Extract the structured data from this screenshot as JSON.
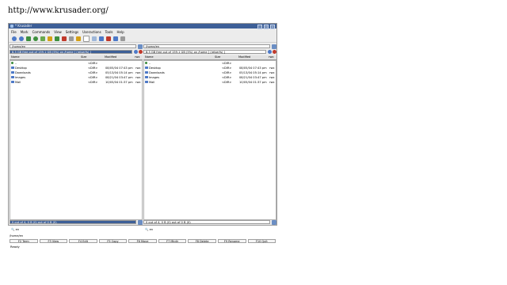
{
  "page_caption": "http://www.krusader.org/",
  "window": {
    "title": "* Krusader"
  },
  "menubar": [
    "File",
    "Mark",
    "Commands",
    "View",
    "Settings",
    "Useractions",
    "Tools",
    "Help"
  ],
  "toolbar": {
    "icons": [
      "back-icon",
      "forward-icon",
      "home-icon",
      "refresh-icon",
      "root-icon",
      "edit-icon",
      "compare-icon",
      "split-icon",
      "combine-icon",
      "copy-icon",
      "paste-icon",
      "search-icon",
      "terminal-icon",
      "settings-icon",
      "locate-icon",
      "key-icon"
    ],
    "colors": {
      "green": "#3e8f3e",
      "red": "#c0392b",
      "yellow": "#d4a017",
      "gray": "#9a9a9a",
      "blue": "#4d79c7"
    }
  },
  "left_panel": {
    "path": "/home/en",
    "free_space": "8.3 GB free out of 159.1 GB (5%) on /home [ (reiserfs) ]",
    "columns": [
      "Name",
      "Size",
      "Modified",
      "rwx"
    ],
    "rows": [
      {
        "name": "..",
        "size": "<DIR>",
        "modified": "",
        "perm": ""
      },
      {
        "name": "Desktop",
        "size": "<DIR>",
        "modified": "08/05/04 07:43 pm",
        "perm": "rwx"
      },
      {
        "name": "Downloads",
        "size": "<DIR>",
        "modified": "05/13/04 05:14 pm",
        "perm": "rwx"
      },
      {
        "name": "Images",
        "size": "<DIR>",
        "modified": "08/21/04 03:47 pm",
        "perm": "rwx"
      },
      {
        "name": "Mail",
        "size": "<DIR>",
        "modified": "10/05/04 01:37 pm",
        "perm": "rwx"
      }
    ],
    "status": "0 out of 4, 0 B (0) out of 0 B (0)",
    "quicksearch": "en"
  },
  "right_panel": {
    "path": "/home/en",
    "free_space": "8.3 GB free out of 159.1 GB (5%) on /home [ (reiserfs) ]",
    "columns": [
      "Name",
      "Size",
      "Modified",
      "rwx"
    ],
    "rows": [
      {
        "name": "..",
        "size": "<DIR>",
        "modified": "",
        "perm": ""
      },
      {
        "name": "Desktop",
        "size": "<DIR>",
        "modified": "08/05/04 07:43 pm",
        "perm": "rwx"
      },
      {
        "name": "Downloads",
        "size": "<DIR>",
        "modified": "05/13/04 05:14 pm",
        "perm": "rwx"
      },
      {
        "name": "Images",
        "size": "<DIR>",
        "modified": "08/21/04 03:47 pm",
        "perm": "rwx"
      },
      {
        "name": "Mail",
        "size": "<DIR>",
        "modified": "10/05/04 01:37 pm",
        "perm": "rwx"
      }
    ],
    "status": "0 out of 4, 0 B (0) out of 0 B (0)",
    "quicksearch": "en"
  },
  "cmdline": {
    "prompt": "/home/en"
  },
  "fkeys": [
    "F2 Term",
    "F3 View",
    "F4 Edit",
    "F5 Copy",
    "F6 Move",
    "F7 Mkdir",
    "F8 Delete",
    "F9 Rename",
    "F10 Quit"
  ],
  "statusbar": "Ready",
  "colors": {
    "accent": "#3d5f97",
    "folder": "#4d79c7"
  }
}
